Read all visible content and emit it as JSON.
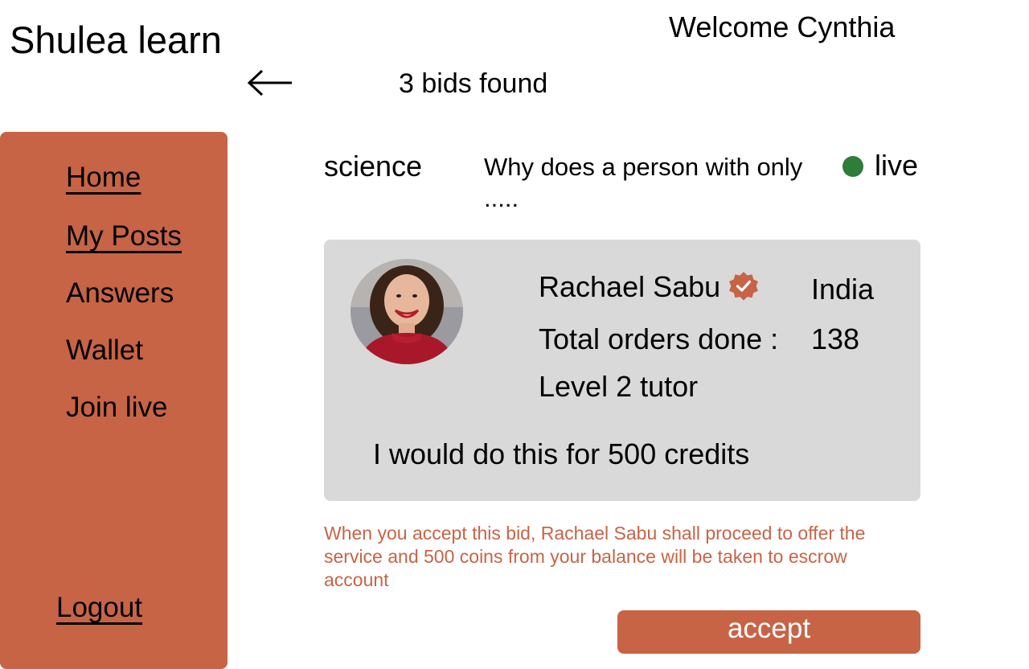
{
  "header": {
    "app_title": "Shulea learn",
    "welcome": "Welcome Cynthia",
    "bids_found": "3 bids found"
  },
  "sidebar": {
    "items": [
      {
        "label": "Home"
      },
      {
        "label": "My Posts"
      },
      {
        "label": "Answers"
      },
      {
        "label": "Wallet"
      },
      {
        "label": "Join live"
      }
    ],
    "logout": "Logout"
  },
  "post": {
    "subject": "science",
    "question": "Why does a person with only .....",
    "status": "live"
  },
  "bid": {
    "tutor_name": "Rachael Sabu",
    "country": "India",
    "orders_label": "Total orders done :",
    "orders_value": "138",
    "level": "Level 2 tutor",
    "offer": "I would do this for 500 credits"
  },
  "notice": "When you accept this bid, Rachael Sabu shall proceed to offer the service and 500 coins from your balance  will be taken to escrow account",
  "actions": {
    "accept_label": "accept"
  },
  "colors": {
    "accent": "#c76446",
    "card_bg": "#d9d9d9",
    "live_status": "#2e7d3a"
  },
  "icons": {
    "back": "arrow-left-icon",
    "verified": "verified-badge-icon",
    "live": "live-status-dot-icon"
  }
}
